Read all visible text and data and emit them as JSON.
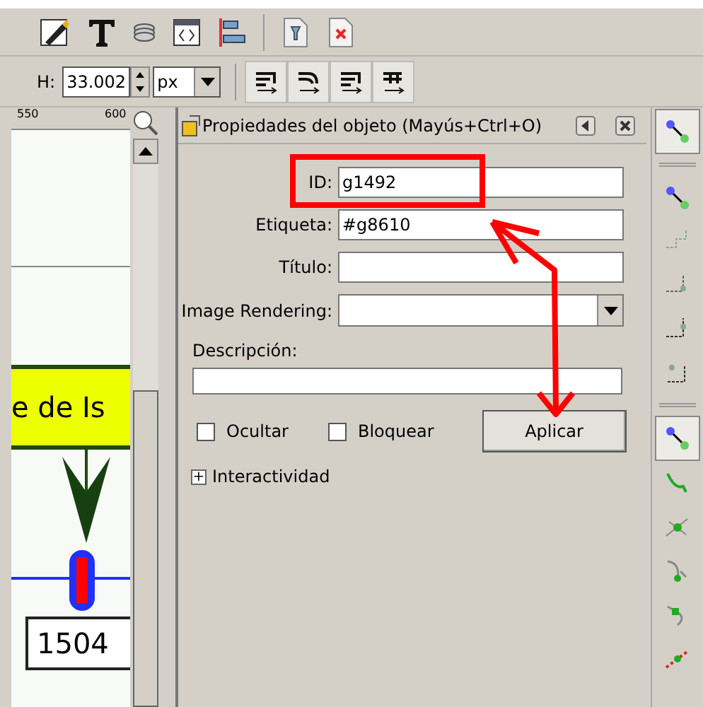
{
  "toolbar": {
    "height_label": "H:",
    "height_value": "33.002",
    "unit": "px"
  },
  "ruler": {
    "ticks": [
      "550",
      "600"
    ]
  },
  "canvas": {
    "box_text": "e de Is",
    "node_label": "1504"
  },
  "dialog": {
    "title": "Propiedades del objeto (Mayús+Ctrl+O)",
    "fields": [
      {
        "kind": "input",
        "label": "ID:",
        "value": "g1492"
      },
      {
        "kind": "input",
        "label": "Etiqueta:",
        "value": "#g8610"
      },
      {
        "kind": "input",
        "label": "Título:"
      },
      {
        "kind": "dropdown",
        "label": "Image Rendering:"
      }
    ],
    "description_label": "Descripción:",
    "checkboxes": [
      {
        "label": "Ocultar",
        "checked": false
      },
      {
        "label": "Bloquear",
        "checked": false
      }
    ],
    "apply_button": "Aplicar",
    "expander": {
      "symbol": "+",
      "label": "Interactividad",
      "expanded": false
    }
  },
  "right_toolbar": [
    [
      {
        "selected": true
      }
    ],
    [
      {
        "selected": false
      },
      {
        "selected": false
      },
      {
        "selected": false
      },
      {
        "selected": false
      },
      {
        "selected": false
      }
    ],
    [
      {
        "selected": true
      },
      {
        "selected": false
      },
      {
        "selected": false
      },
      {
        "selected": false
      },
      {
        "selected": false
      },
      {
        "selected": false
      }
    ]
  ]
}
